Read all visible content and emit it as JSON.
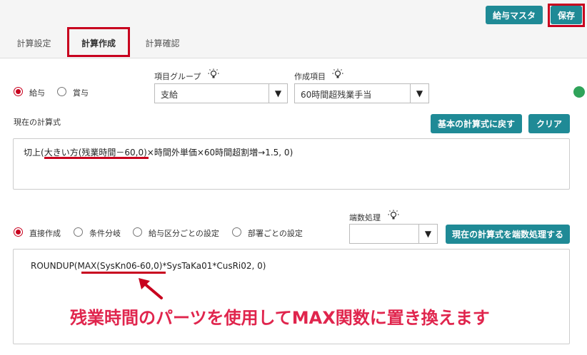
{
  "header": {
    "master_button": "給与マスタ",
    "save_button": "保存"
  },
  "tabs": [
    {
      "label": "計算設定"
    },
    {
      "label": "計算作成"
    },
    {
      "label": "計算確認"
    }
  ],
  "payment_type": {
    "options": [
      "給与",
      "賞与"
    ],
    "selected": "給与"
  },
  "item_group": {
    "label": "項目グループ",
    "value": "支給"
  },
  "create_item": {
    "label": "作成項目",
    "value": "60時間超残業手当"
  },
  "current_formula": {
    "label": "現在の計算式",
    "reset_button": "基本の計算式に戻す",
    "clear_button": "クリア",
    "prefix": "切上(",
    "highlight": "大きい方(残業時間－60,0)",
    "suffix": "×時間外単価×60時間超割増→1.5, 0)"
  },
  "creation_mode": {
    "options": [
      "直接作成",
      "条件分岐",
      "給与区分ごとの設定",
      "部署ごとの設定"
    ],
    "selected": "直接作成"
  },
  "rounding": {
    "label": "端数処理",
    "value": "",
    "apply_button": "現在の計算式を端数処理する"
  },
  "direct_formula": {
    "prefix": "ROUNDUP(",
    "highlight": "MAX(SysKn06-60,0)",
    "suffix": "*SysTaKa01*CusRi02, 0)"
  },
  "annotation": "残業時間のパーツを使用してMAX関数に置き換えます",
  "colors": {
    "accent": "#1f8a96",
    "highlight_red": "#c8001e",
    "annotation": "#e0254d"
  },
  "icons": [
    "lightbulb-icon",
    "dropdown-arrow-icon",
    "arrow-icon",
    "check-icon"
  ]
}
